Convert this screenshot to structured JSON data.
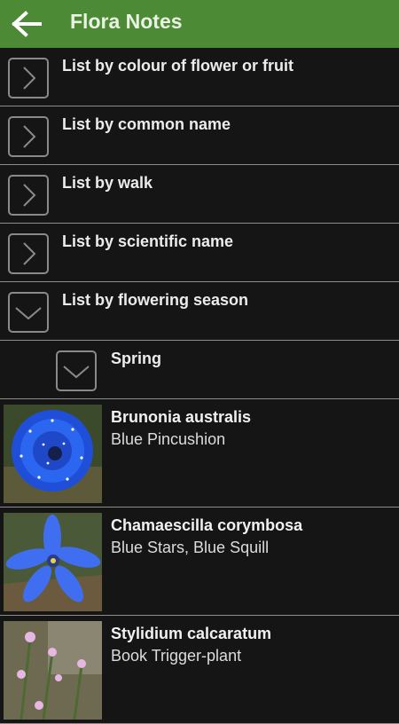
{
  "app": {
    "title": "Flora Notes"
  },
  "menu": [
    {
      "label": "List by colour of flower or fruit",
      "state": "collapsed"
    },
    {
      "label": "List by common name",
      "state": "collapsed"
    },
    {
      "label": "List by walk",
      "state": "collapsed"
    },
    {
      "label": "List by scientific name",
      "state": "collapsed"
    },
    {
      "label": "List by flowering season",
      "state": "expanded"
    }
  ],
  "season": {
    "label": "Spring",
    "state": "expanded"
  },
  "plants": [
    {
      "scientific": "Brunonia australis",
      "common": "Blue Pincushion"
    },
    {
      "scientific": "Chamaescilla corymbosa",
      "common": "Blue Stars, Blue Squill"
    },
    {
      "scientific": "Stylidium calcaratum",
      "common": "Book Trigger-plant"
    }
  ],
  "colors": {
    "appbar": "#4c8a35",
    "background": "#151515",
    "divider": "#8c8c8c"
  },
  "icons": {
    "back": "arrow-left-icon",
    "collapsed": "chevron-right-icon",
    "expanded": "chevron-down-icon"
  }
}
